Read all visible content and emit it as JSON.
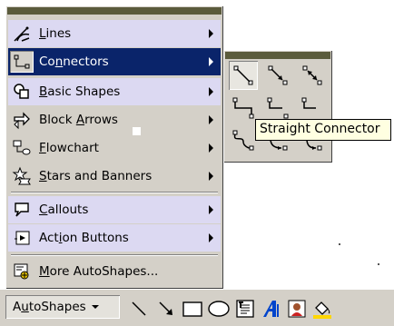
{
  "menu": {
    "items": [
      {
        "label_pre": "",
        "label_key": "L",
        "label_post": "ines",
        "icon": "lines-icon"
      },
      {
        "label_pre": "Co",
        "label_key": "n",
        "label_post": "nectors",
        "icon": "connectors-icon"
      },
      {
        "label_pre": "",
        "label_key": "B",
        "label_post": "asic Shapes",
        "icon": "basic-shapes-icon"
      },
      {
        "label_pre": "Block ",
        "label_key": "A",
        "label_post": "rrows",
        "icon": "block-arrows-icon"
      },
      {
        "label_pre": "",
        "label_key": "F",
        "label_post": "lowchart",
        "icon": "flowchart-icon"
      },
      {
        "label_pre": "",
        "label_key": "S",
        "label_post": "tars and Banners",
        "icon": "stars-banners-icon"
      },
      {
        "label_pre": "",
        "label_key": "C",
        "label_post": "allouts",
        "icon": "callouts-icon"
      },
      {
        "label_pre": "Act",
        "label_key": "i",
        "label_post": "on Buttons",
        "icon": "action-buttons-icon"
      },
      {
        "label_pre": "",
        "label_key": "M",
        "label_post": "ore AutoShapes...",
        "icon": "more-autoshapes-icon"
      }
    ],
    "highlighted": "Connectors"
  },
  "submenu": {
    "tooltip": "Straight Connector"
  },
  "toolbar": {
    "autoshapes_pre": "A",
    "autoshapes_key": "u",
    "autoshapes_post": "toShapes"
  },
  "colors": {
    "menu_bg": "#d4d0c8",
    "highlight": "#0a246a",
    "alt_row": "#dcd9f2",
    "tooltip_bg": "#ffffe1"
  }
}
